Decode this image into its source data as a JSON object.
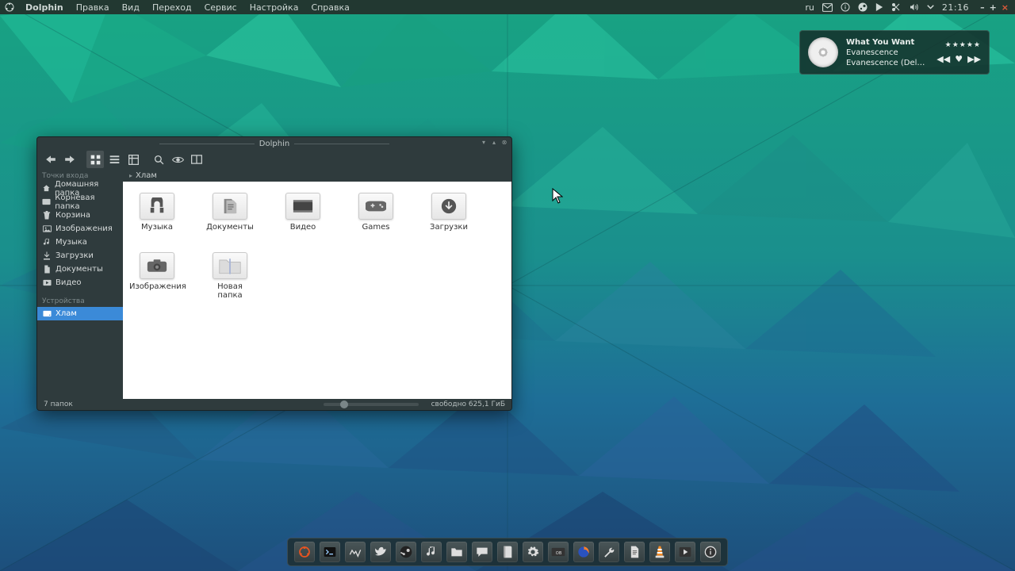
{
  "panel": {
    "app_name": "Dolphin",
    "menus": [
      "Правка",
      "Вид",
      "Переход",
      "Сервис",
      "Настройка",
      "Справка"
    ],
    "layout": "ru",
    "clock": "21:16",
    "tray_icons": [
      "mail-icon",
      "info-icon",
      "steam-icon",
      "play-icon",
      "scissors-icon",
      "volume-icon",
      "chevron-down-icon"
    ],
    "window_controls": [
      "minimize",
      "maximize",
      "close"
    ]
  },
  "music": {
    "title": "What You Want",
    "artist": "Evanescence",
    "album": "Evanescence (Delu...",
    "rating_stars": "★★★★★",
    "controls": [
      "prev",
      "love",
      "next"
    ]
  },
  "dolphin": {
    "window_title": "Dolphin",
    "breadcrumb": "Хлам",
    "sidebar": {
      "section_places": "Точки входа",
      "places": [
        {
          "icon": "home",
          "label": "Домашняя папка"
        },
        {
          "icon": "drive",
          "label": "Корневая папка"
        },
        {
          "icon": "trash",
          "label": "Корзина"
        },
        {
          "icon": "pictures",
          "label": "Изображения"
        },
        {
          "icon": "music",
          "label": "Музыка"
        },
        {
          "icon": "downloads",
          "label": "Загрузки"
        },
        {
          "icon": "documents",
          "label": "Документы"
        },
        {
          "icon": "videos",
          "label": "Видео"
        }
      ],
      "section_devices": "Устройства",
      "devices": [
        {
          "icon": "hdd",
          "label": "Хлам",
          "selected": true
        }
      ]
    },
    "files": [
      {
        "icon": "headphones",
        "label": "Музыка"
      },
      {
        "icon": "documents",
        "label": "Документы"
      },
      {
        "icon": "clapper",
        "label": "Видео"
      },
      {
        "icon": "gamepad",
        "label": "Games"
      },
      {
        "icon": "download",
        "label": "Загрузки"
      },
      {
        "icon": "camera",
        "label": "Изображения"
      },
      {
        "icon": "folder",
        "label": "Новая папка"
      }
    ],
    "status_left": "7 папок",
    "status_right": "свободно 625,1 ГиБ"
  },
  "dock": {
    "items": [
      "ubuntu",
      "terminal",
      "monitor",
      "bird",
      "steam",
      "music",
      "files",
      "chat",
      "book",
      "settings",
      "onboard",
      "firefox",
      "wrench",
      "writer",
      "vlc",
      "media",
      "info"
    ]
  }
}
